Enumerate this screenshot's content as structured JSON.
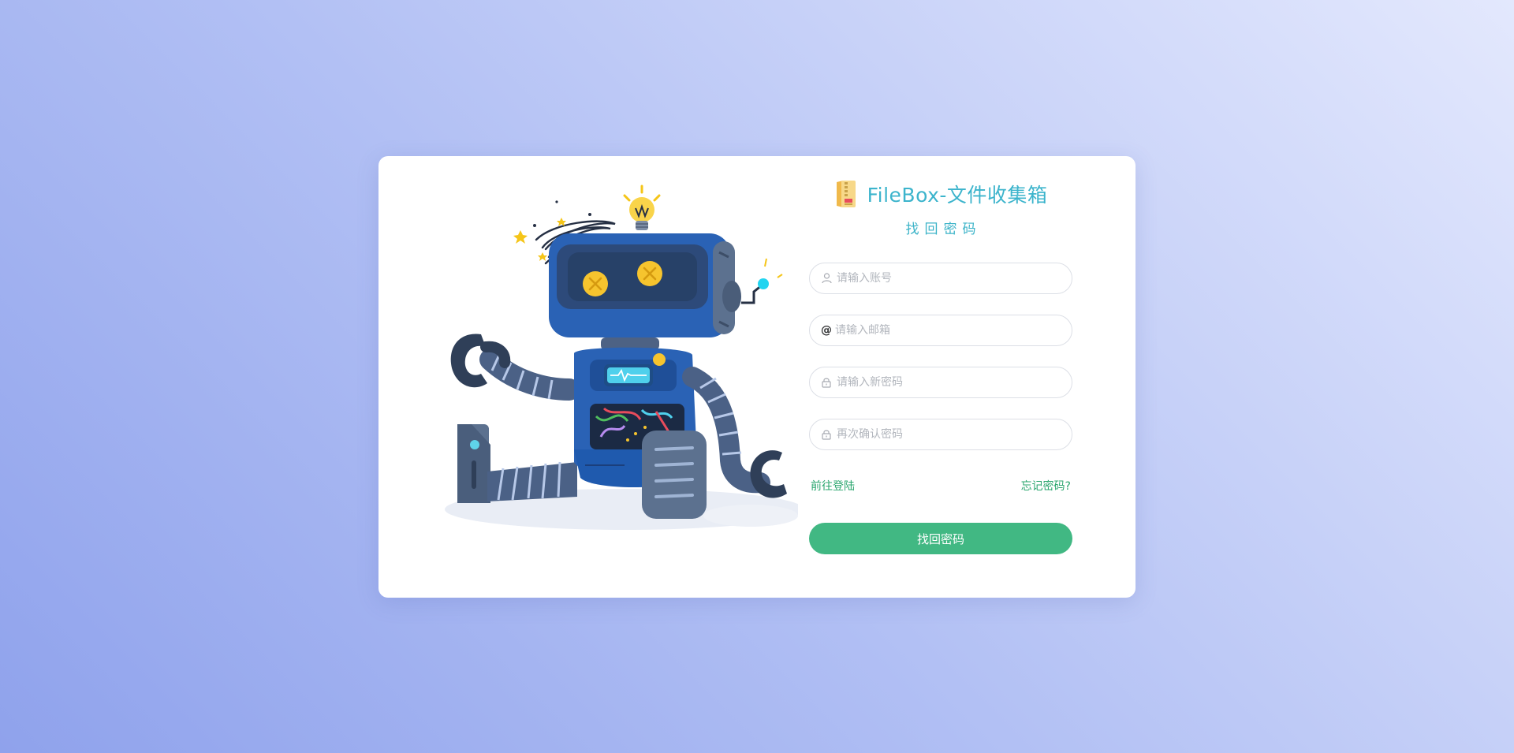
{
  "brand": {
    "title": "FileBox-文件收集箱",
    "logo_icon": "folder-zip-icon"
  },
  "page": {
    "subtitle": "找回密码"
  },
  "form": {
    "account": {
      "placeholder": "请输入账号",
      "value": "",
      "icon": "user-icon"
    },
    "email": {
      "placeholder": "请输入邮箱",
      "value": "",
      "icon": "at-sign-icon",
      "icon_text": "@"
    },
    "new_password": {
      "placeholder": "请输入新密码",
      "value": "",
      "icon": "lock-icon"
    },
    "confirm_password": {
      "placeholder": "再次确认密码",
      "value": "",
      "icon": "lock-icon"
    }
  },
  "links": {
    "to_login": "前往登陆",
    "forgot_password": "忘记密码?"
  },
  "submit_label": "找回密码",
  "colors": {
    "accent_green": "#41b883",
    "link_green": "#2aa66e",
    "title_cyan": "#3cb4cc",
    "background_start": "#8fa2ec",
    "background_end": "#e3e8fd"
  }
}
